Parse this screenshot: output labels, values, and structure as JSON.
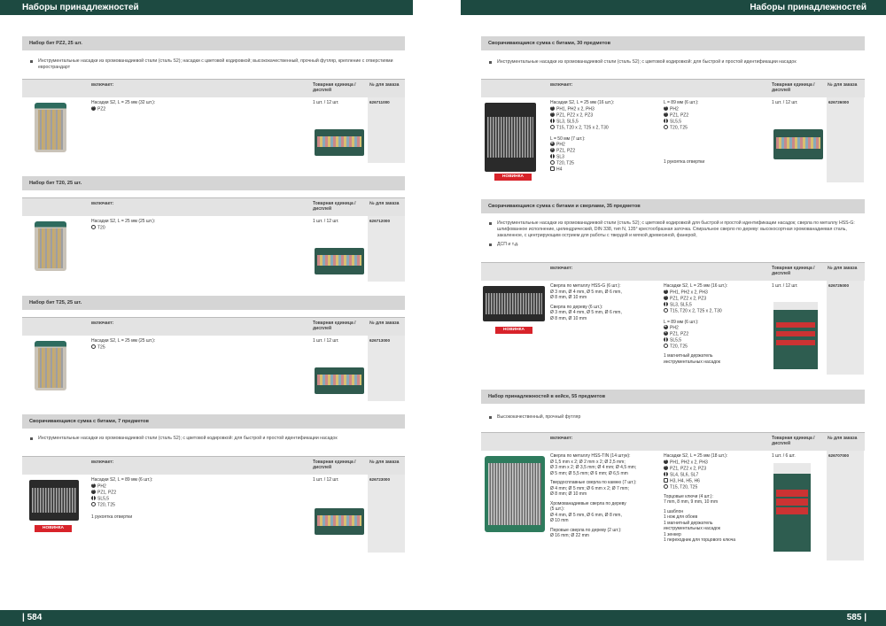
{
  "header": {
    "left_title": "Наборы принадлежностей",
    "right_title": "Наборы принадлежностей"
  },
  "footer": {
    "left_page": "| 584",
    "right_page": "585 |"
  },
  "cols": {
    "includes": "включает:",
    "unit": "Товарная единица / дисплей",
    "order": "№ для заказа"
  },
  "s1": {
    "title": "Набор бит PZ2, 25 шт.",
    "bullet": "Инструментальные насадки из хромованадиевой стали (сталь S2); насадки с цветовой кодировкой; высококачественный, прочный футляр, крепление с отверстиями евространдарт",
    "line1": "Насадки S2, L = 25 мм (32 шт.):",
    "i1": "PZ2",
    "unit": "1 шт. / 12 шт.",
    "order": "626711000"
  },
  "s2": {
    "title": "Набор бит T20, 25 шт.",
    "line1": "Насадки S2, L = 25 мм (25 шт.):",
    "i1": "T20",
    "unit": "1 шт. / 12 шт.",
    "order": "626712000"
  },
  "s3": {
    "title": "Набор бит T25, 25 шт.",
    "line1": "Насадки S2, L = 25 мм (25 шт.):",
    "i1": "T25",
    "unit": "1 шт. / 12 шт.",
    "order": "626713000"
  },
  "s4": {
    "title": "Сворачивающаяся сумка с битами, 7 предметов",
    "bullet": "Инструментальные насадки из хромованадиевой стали (сталь S2); с цветовой кодировкой: для быстрой и простой идентификации насадок",
    "line1": "Насадки S2, L = 89 мм (6 шт.):",
    "i1": "PH2",
    "i2": "PZ1, PZ2",
    "i3": "SL5,5",
    "i4": "T20, T25",
    "extra": "1 рукоятка отвертки",
    "badge": "НОВИНКА",
    "unit": "1 шт. / 12 шт.",
    "order": "626723000"
  },
  "s5": {
    "title": "Сворачивающаяся сумка с битами, 30 предметов",
    "bullet": "Инструментальные насадки из хромованадиевой стали (сталь S2); с цветовой кодировкой: для быстрой и простой идентификации насадок",
    "a_line": "Насадки S2, L = 25 мм (16 шт.):",
    "a1": "PH1, PH2 x 2, PH3",
    "a2": "PZ1, PZ2 x 2, PZ3",
    "a3": "SL3, SL5,5",
    "a4": "T15, T20 x 2, T25 x 2, T30",
    "b_line": "L = 50 мм (7 шт.):",
    "b1": "PH2",
    "b2": "PZ1, PZ2",
    "b3": "SL3",
    "b4": "T20, T25",
    "b5": "H4",
    "c_line": "L = 89 мм (6 шт.):",
    "c1": "PH2",
    "c2": "PZ1, PZ2",
    "c3": "SL5,5",
    "c4": "T20, T25",
    "extra": "1 рукоятка отвертки",
    "badge": "НОВИНКА",
    "unit": "1 шт. / 12 шт.",
    "order": "626726000"
  },
  "s6": {
    "title": "Сворачивающаяся сумка с битами и сверлами, 35 предметов",
    "bullet1": "Инструментальные насадки из хромованадиевой стали (сталь S2); с цветовой кодировкой для быстрой и простой идентификации насадок; сверла по металлу HSS-G: шлифованное исполнение, цилиндрический, DIN 338, тип N, 135° крестообразная заточка. Спиральное сверло по дереву: высокосортная хромованадиевая сталь, закаленное, с центрирующим острием для работы с твердой и мягкой древесиной, фанерой,",
    "bullet2": "ДСП и т.д.",
    "d1": "Сверла по металлу HSS-G (6 шт.):",
    "d2": "Ø 3 mm, Ø 4 mm, Ø 5 mm, Ø 6 mm,",
    "d3": "Ø 8 mm, Ø 10 mm",
    "d4": "Сверла по дереву (6 шт.):",
    "d5": "Ø 3 mm, Ø 4 mm, Ø 5 mm, Ø 6 mm,",
    "d6": "Ø 8 mm, Ø 10 mm",
    "a_line": "Насадки S2, L = 25 мм (16 шт.):",
    "a1": "PH1, PH2 x 2, PH3",
    "a2": "PZ1, PZ2 x 2, PZ3",
    "a3": "SL3, SL5,5",
    "a4": "T15, T20 x 2, T25 x 2, T30",
    "c_line": "L = 89 мм (6 шт.):",
    "c1": "PH2",
    "c2": "PZ1, PZ2",
    "c3": "SL5,5",
    "c4": "T20, T25",
    "extra1": "1 магнитный держатель",
    "extra2": "инструментальных насадок",
    "badge": "НОВИНКА",
    "unit": "1 шт. / 12 шт.",
    "order": "626725000"
  },
  "s7": {
    "title": "Набор принадлежностей в кейсе, 55 предметов",
    "bullet": "Высококачественный, прочный футляр",
    "l1": "Сверла по металлу HSS-TIN (14 штук):",
    "l2": "Ø 1,5 mm x 2; Ø 2 mm x 2; Ø 2,5 mm;",
    "l3": "Ø 3 mm x 2; Ø 3,5 mm; Ø 4 mm; Ø 4,5 mm;",
    "l4": "Ø 5 mm; Ø 5,5 mm; Ø 6 mm; Ø 6,5 mm",
    "l5": "Твердосплавные сверла по камню (7 шт.):",
    "l6": "Ø 4 mm; Ø 5 mm; Ø 6 mm x 2; Ø 7 mm;",
    "l7": "Ø 8 mm; Ø 10 mm",
    "l8": "Хромованадиевые сверла по дереву",
    "l9": "(5 шт.):",
    "l10": "Ø 4 mm, Ø 5 mm, Ø 6 mm, Ø 8 mm,",
    "l11": "Ø 10 mm",
    "l12": "Перовые сверла по дереву (2 шт.):",
    "l13": "Ø 16 mm; Ø 22 mm",
    "r_line": "Насадки S2, L = 25 мм (18 шт.):",
    "r1": "PH1, PH2 x 2, PH3",
    "r2": "PZ1, PZ2 x 2, PZ3",
    "r3": "SL4, SL6, SL7",
    "r4": "H3, H4, H5, H6",
    "r5": "T15, T20, T25",
    "r6": "Торцовые ключи (4 шт.):",
    "r7": "7 mm, 8 mm, 9 mm, 10 mm",
    "r8": "1 шаблон",
    "r9": "1 нож для обоев",
    "r10": "1 магнитный держатель",
    "r11": "инструментальных насадок",
    "r12": "1 зенкер",
    "r13": "1 переходник для торцового ключа",
    "unit": "1 шт. / 6 шт.",
    "order": "626707000"
  }
}
